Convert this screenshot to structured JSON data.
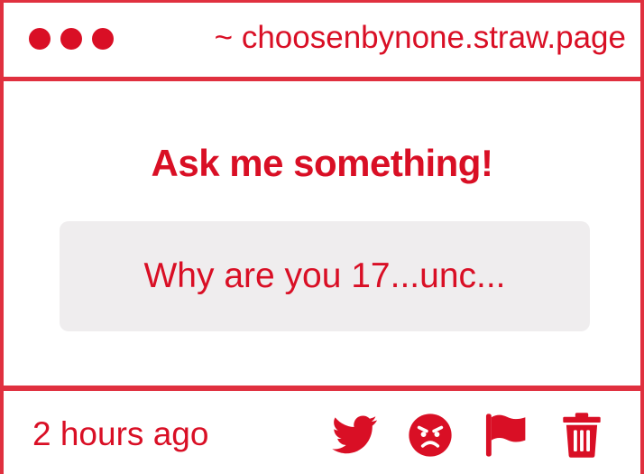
{
  "window": {
    "controls": [
      "close-dot",
      "minimize-dot",
      "maximize-dot"
    ],
    "url": "~ choosenbynone.straw.page"
  },
  "main": {
    "heading": "Ask me something!",
    "question": "Why are you 17...unc..."
  },
  "footer": {
    "timestamp": "2 hours ago",
    "actions": [
      "twitter-icon",
      "angry-face-icon",
      "flag-icon",
      "trash-icon"
    ]
  },
  "colors": {
    "accent": "#d90f25",
    "border": "#e0303f",
    "question_bg": "#efedee"
  }
}
